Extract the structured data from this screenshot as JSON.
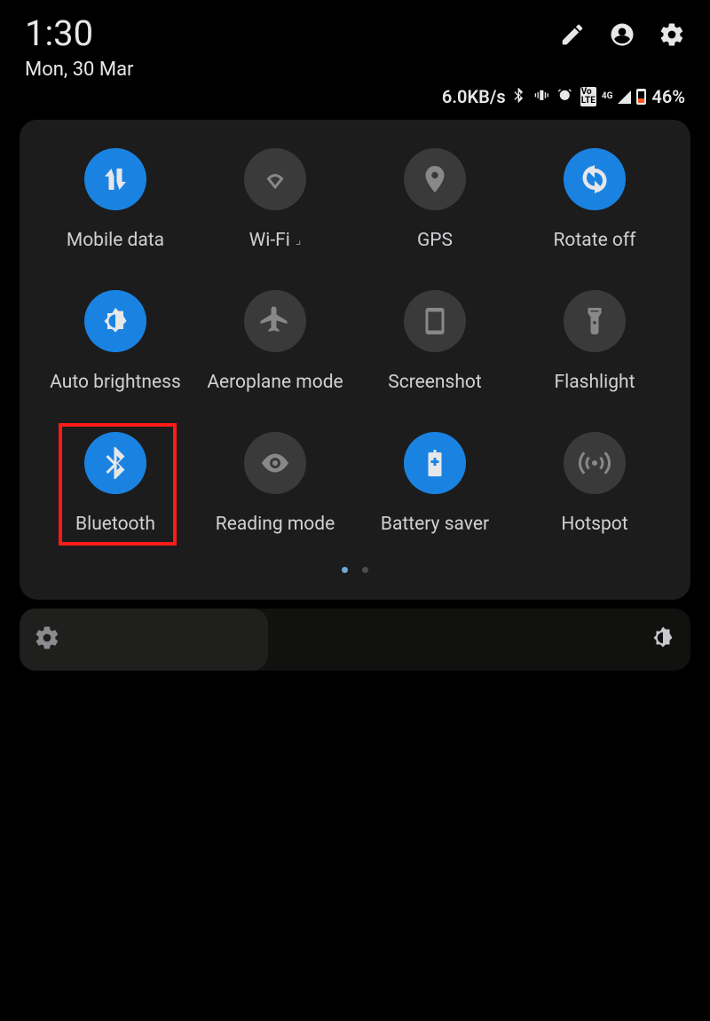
{
  "header": {
    "time": "1:30",
    "date": "Mon, 30 Mar"
  },
  "status": {
    "speed": "6.0KB/s",
    "battery_pct": "46%",
    "volte": "Vo\nLTE",
    "net": "4G"
  },
  "tiles": [
    {
      "key": "mobile-data",
      "label": "Mobile data",
      "active": true,
      "icon": "arrows-up-down"
    },
    {
      "key": "wifi",
      "label": "Wi-Fi",
      "active": false,
      "icon": "wifi",
      "suffix": "⌟"
    },
    {
      "key": "gps",
      "label": "GPS",
      "active": false,
      "icon": "location"
    },
    {
      "key": "rotate",
      "label": "Rotate off",
      "active": true,
      "icon": "rotate"
    },
    {
      "key": "auto-brightness",
      "label": "Auto brightness",
      "active": true,
      "icon": "brightness-auto"
    },
    {
      "key": "aeroplane",
      "label": "Aeroplane mode",
      "active": false,
      "icon": "airplane"
    },
    {
      "key": "screenshot",
      "label": "Screenshot",
      "active": false,
      "icon": "phone-frame"
    },
    {
      "key": "flashlight",
      "label": "Flashlight",
      "active": false,
      "icon": "flashlight"
    },
    {
      "key": "bluetooth",
      "label": "Bluetooth",
      "active": true,
      "icon": "bluetooth",
      "highlight": true
    },
    {
      "key": "reading",
      "label": "Reading mode",
      "active": false,
      "icon": "eye"
    },
    {
      "key": "battery-saver",
      "label": "Battery saver",
      "active": true,
      "icon": "battery-plus"
    },
    {
      "key": "hotspot",
      "label": "Hotspot",
      "active": false,
      "icon": "hotspot"
    }
  ],
  "pager": {
    "count": 2,
    "active": 0
  },
  "brightness": {
    "value_pct": 37
  }
}
